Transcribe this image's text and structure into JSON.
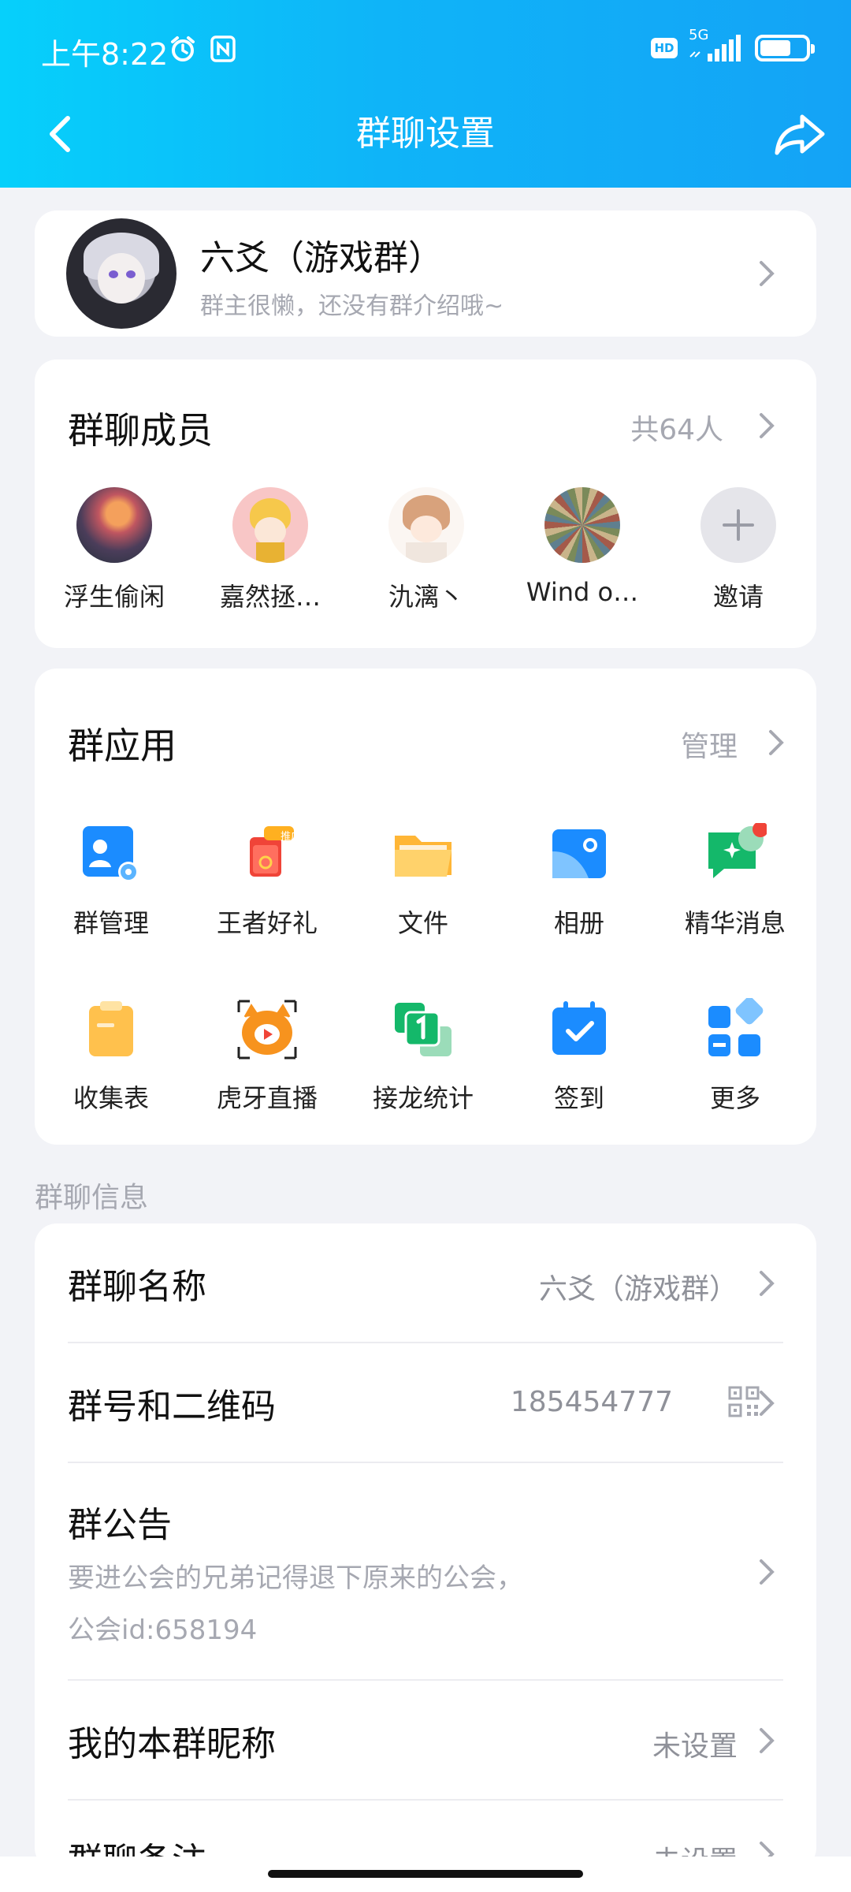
{
  "status_bar": {
    "time": "上午8:22",
    "network": "5G",
    "hd": "HD",
    "icons": [
      "alarm-icon",
      "nfc-icon",
      "signal-icon",
      "battery-icon"
    ]
  },
  "nav": {
    "title": "群聊设置",
    "back_icon": "chevron-left-icon",
    "share_icon": "share-icon"
  },
  "group": {
    "name": "六爻（游戏群）",
    "description": "群主很懒，还没有群介绍哦~"
  },
  "members": {
    "title": "群聊成员",
    "count_label": "共64人",
    "list": [
      {
        "name": "浮生偷闲"
      },
      {
        "name": "嘉然拯…"
      },
      {
        "name": "氿漓丶"
      },
      {
        "name": "Wind o…"
      }
    ],
    "invite_label": "邀请"
  },
  "apps": {
    "title": "群应用",
    "manage_label": "管理",
    "items": [
      {
        "label": "群管理",
        "icon": "group-admin-icon"
      },
      {
        "label": "王者好礼",
        "icon": "gift-icon"
      },
      {
        "label": "文件",
        "icon": "folder-icon"
      },
      {
        "label": "相册",
        "icon": "album-icon"
      },
      {
        "label": "精华消息",
        "icon": "highlight-message-icon"
      },
      {
        "label": "收集表",
        "icon": "clipboard-icon"
      },
      {
        "label": "虎牙直播",
        "icon": "huya-live-icon"
      },
      {
        "label": "接龙统计",
        "icon": "chain-stat-icon"
      },
      {
        "label": "签到",
        "icon": "checkin-calendar-icon"
      },
      {
        "label": "更多",
        "icon": "more-grid-icon"
      }
    ],
    "gift_badge": "推广"
  },
  "info": {
    "section_title": "群聊信息",
    "rows": {
      "name": {
        "label": "群聊名称",
        "value": "六爻（游戏群）"
      },
      "number": {
        "label": "群号和二维码",
        "value": "185454777"
      },
      "notice": {
        "label": "群公告",
        "line1": "要进公会的兄弟记得退下原来的公会，",
        "line2": "公会id:658194"
      },
      "nickname": {
        "label": "我的本群昵称",
        "value": "未设置"
      },
      "remark": {
        "label": "群聊备注",
        "value": "未设置"
      }
    }
  },
  "colors": {
    "header_start": "#06d0fb",
    "header_end": "#14a3f6",
    "accent_blue": "#1b8cff",
    "badge_red": "#f04438"
  }
}
